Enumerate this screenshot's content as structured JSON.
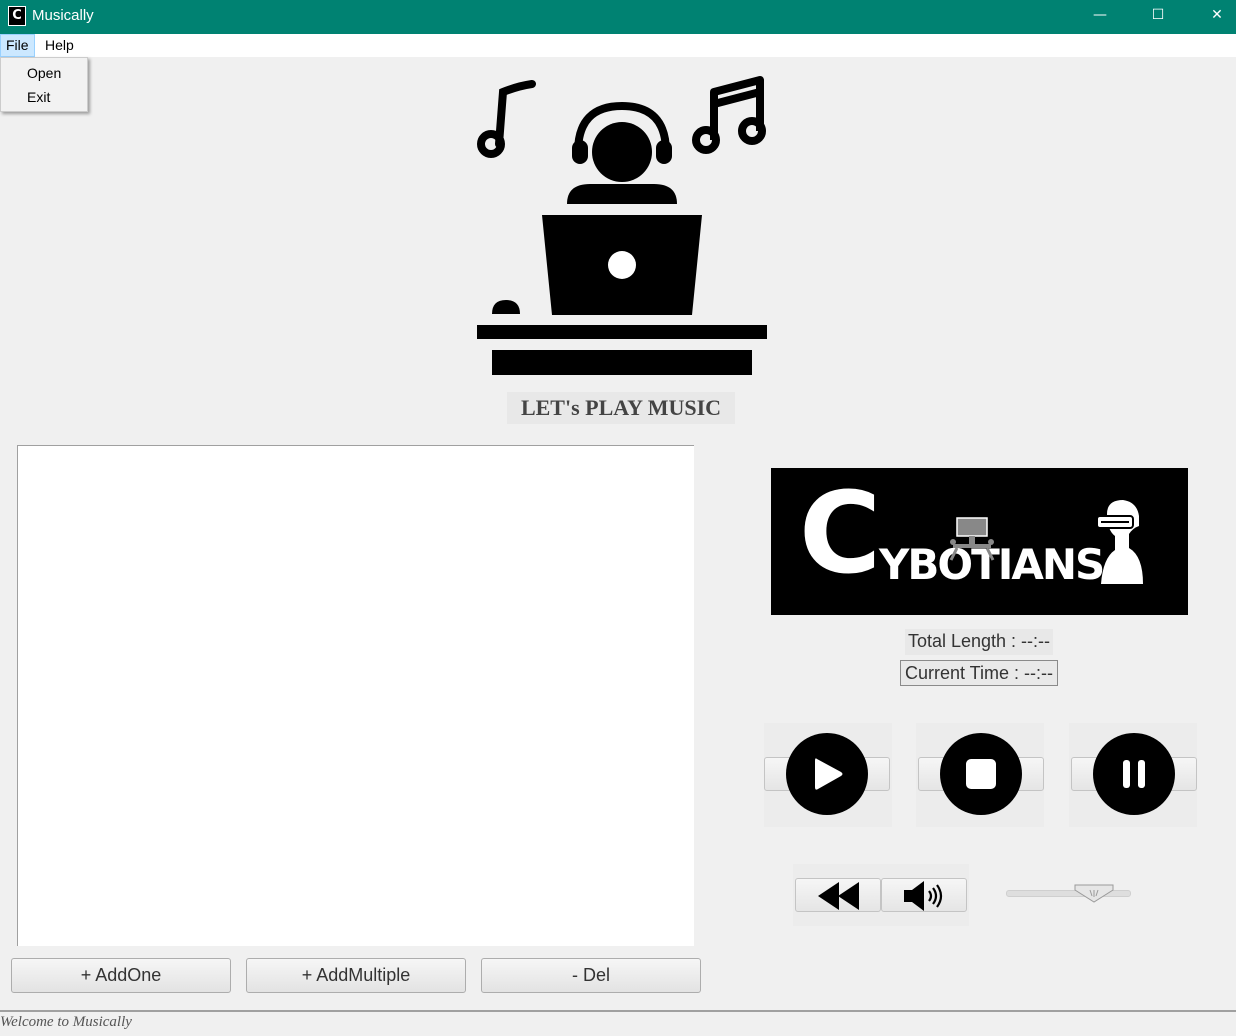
{
  "window": {
    "title": "Musically",
    "icon_letter": "C",
    "minimize_glyph": "—",
    "maximize_glyph": "☐",
    "close_glyph": "✕"
  },
  "menu": {
    "items": [
      {
        "label": "File"
      },
      {
        "label": "Help"
      }
    ],
    "file_dropdown": [
      {
        "label": "Open"
      },
      {
        "label": "Exit"
      }
    ]
  },
  "banner": {
    "title": "LET's PLAY MUSIC"
  },
  "logo": {
    "initial": "C",
    "text": "YBOTIANS"
  },
  "player": {
    "total_length": "Total Length : --:--",
    "current_time": "Current Time : --:--",
    "controls": [
      "play-icon",
      "stop-icon",
      "pause-icon"
    ],
    "secondary_controls": [
      "rewind-icon",
      "volume-icon"
    ]
  },
  "playlist_buttons": {
    "add_one": "+ AddOne",
    "add_multiple": "+ AddMultiple",
    "delete": "- Del"
  },
  "status": {
    "text": "Welcome to Musically"
  }
}
